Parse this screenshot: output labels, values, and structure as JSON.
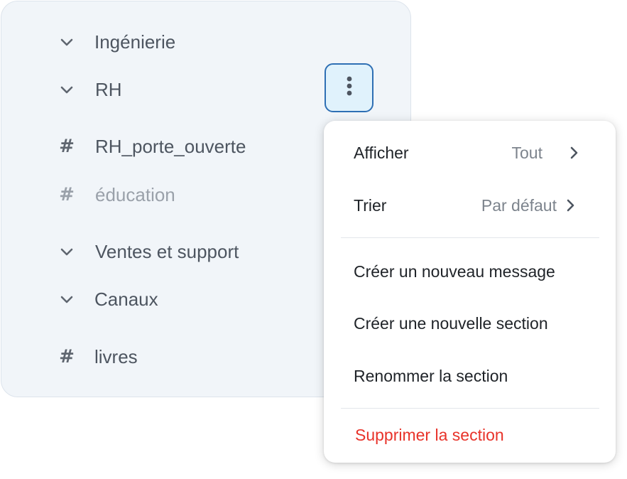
{
  "sidebar": {
    "items": [
      {
        "kind": "section",
        "label": "Ingénierie",
        "icon": "chevron-down-icon"
      },
      {
        "kind": "section",
        "label": "RH",
        "icon": "chevron-down-icon"
      },
      {
        "kind": "channel",
        "label": "RH_porte_ouverte",
        "icon": "hash-icon",
        "hash": "#"
      },
      {
        "kind": "channel",
        "label": "éducation",
        "icon": "hash-icon",
        "hash": "#",
        "muted": true
      },
      {
        "kind": "section",
        "label": "Ventes et support",
        "icon": "chevron-down-icon"
      },
      {
        "kind": "section",
        "label": "Canaux",
        "icon": "chevron-down-icon"
      },
      {
        "kind": "channel",
        "label": "livres",
        "icon": "hash-icon",
        "hash": "#"
      }
    ],
    "more_button_icon": "more-vertical-icon"
  },
  "menu": {
    "display": {
      "label": "Afficher",
      "value": "Tout",
      "icon": "chevron-right-icon"
    },
    "sort": {
      "label": "Trier",
      "value": "Par défaut",
      "icon": "chevron-right-icon"
    },
    "new_message": "Créer un nouveau message",
    "new_section": "Créer une nouvelle section",
    "rename_section": "Renommer la section",
    "delete_section": "Supprimer la section"
  },
  "colors": {
    "sidebar_bg": "#f1f5f9",
    "text": "#4d5560",
    "muted_text": "#9aa1aa",
    "focus_border": "#2e6fb4",
    "focus_bg": "#e0f2fc",
    "danger": "#e8332a"
  }
}
